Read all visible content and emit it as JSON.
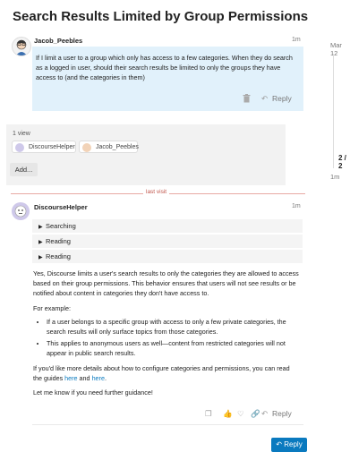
{
  "topic": {
    "title": "Search Results Limited by Group Permissions"
  },
  "post1": {
    "username": "Jacob_Peebles",
    "age": "1m",
    "body": "If I limit a user to a group which only has access to a few categories. When they do search as a logged in user, should their search results be limited to only the groups they have access to (and the categories in them)",
    "reply_label": "Reply"
  },
  "meta": {
    "views": "1 view",
    "participants": [
      "DiscourseHelper",
      "Jacob_Peebles"
    ],
    "add_label": "Add..."
  },
  "last_visit": "last visit",
  "post2": {
    "username": "DiscourseHelper",
    "age": "1m",
    "details": [
      "Searching",
      "Reading",
      "Reading"
    ],
    "para1": "Yes, Discourse limits a user's search results to only the categories they are allowed to access based on their group permissions. This behavior ensures that users will not see results or be notified about content in categories they don't have access to.",
    "para2": "For example:",
    "bullets": [
      "If a user belongs to a specific group with access to only a few private categories, the search results will only surface topics from those categories.",
      "This applies to anonymous users as well—content from restricted categories will not appear in public search results."
    ],
    "para3_a": "If you'd like more details about how to configure categories and permissions, you can read the guides ",
    "link1": "here",
    "para3_and": " and ",
    "link2": "here",
    "para3_end": ".",
    "para4": "Let me know if you need further guidance!",
    "reply_label": "Reply"
  },
  "timeline": {
    "date": "Mar 12",
    "count": "2 / 2",
    "age": "1m"
  },
  "footer": {
    "reply_label": "Reply"
  }
}
